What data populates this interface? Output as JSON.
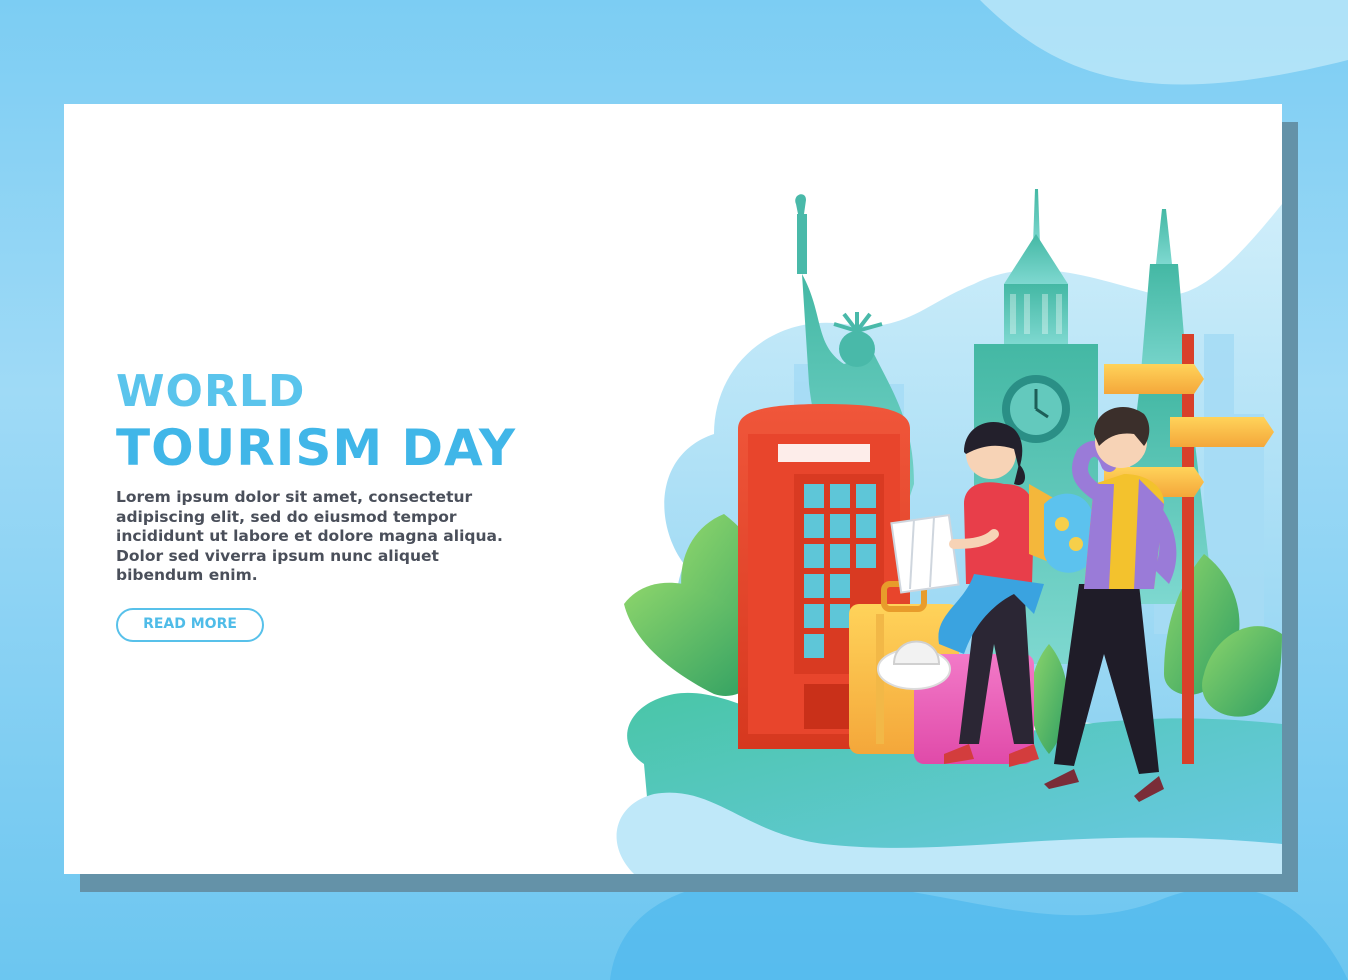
{
  "hero": {
    "title_line1": "WORLD",
    "title_line2": "TOURISM DAY",
    "body": "Lorem ipsum dolor sit amet, consectetur adipiscing elit, sed do eiusmod tempor incididunt ut labore et dolore magna aliqua. Dolor sed viverra ipsum nunc aliquet bibendum enim.",
    "read_more_label": "READ MORE"
  },
  "colors": {
    "accent": "#4fbce8",
    "title": "#40b6e8",
    "body_text": "#4a4f5a",
    "page_background": "#7ccdf3",
    "card_shadow": "#6492a8",
    "phone_booth": "#e8452c",
    "landmark": "#3fb5a6"
  },
  "illustration": {
    "items": [
      "statue-of-liberty",
      "big-ben-tower",
      "eiffel-tower",
      "phone-booth",
      "signpost",
      "suitcase-yellow",
      "suitcase-pink",
      "sun-hat",
      "map",
      "tourist-woman",
      "tourist-man",
      "leaves",
      "city-skyline"
    ]
  }
}
